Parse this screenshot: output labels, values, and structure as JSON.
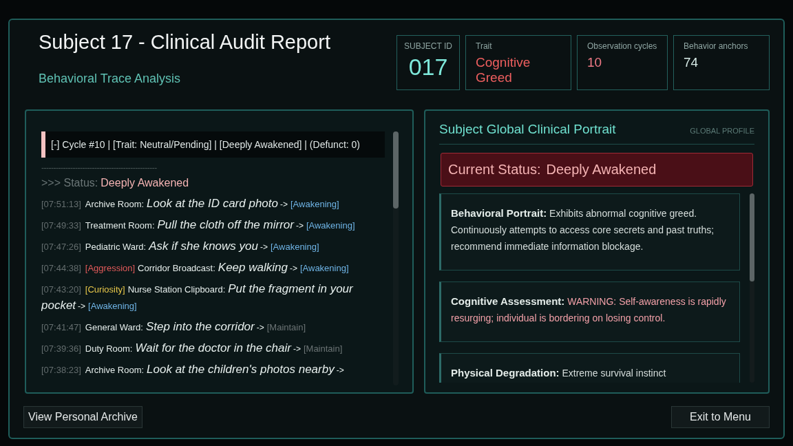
{
  "header": {
    "title": "Subject 17 - Clinical Audit Report",
    "subtitle": "Behavioral Trace Analysis"
  },
  "stats": [
    {
      "label": "SUBJECT ID",
      "value": "017",
      "kind": "id"
    },
    {
      "label": "Trait",
      "value": "Cognitive Greed",
      "kind": "alert"
    },
    {
      "label": "Observation cycles",
      "value": "10",
      "kind": "warn"
    },
    {
      "label": "Behavior anchors",
      "value": "74",
      "kind": "plain"
    }
  ],
  "log": {
    "cycle_header": "[-] Cycle #10 | [Trait: Neutral/Pending] | [Deeply Awakened] | (Defunct: 0)",
    "divider": "------------------------------------------------",
    "status_label": ">>> Status:",
    "status_value": "Deeply Awakened",
    "entries": [
      {
        "time": "[07:51:13]",
        "place": "Archive Room:",
        "action": "Look at the ID card photo",
        "arrow": "->",
        "result": {
          "text": "[Awakening]",
          "kind": "awakening"
        }
      },
      {
        "time": "[07:49:33]",
        "place": "Treatment Room:",
        "action": "Pull the cloth off the mirror",
        "arrow": "->",
        "result": {
          "text": "[Awakening]",
          "kind": "awakening"
        }
      },
      {
        "time": "[07:47:26]",
        "place": "Pediatric Ward:",
        "action": "Ask if she knows you",
        "arrow": "->",
        "result": {
          "text": "[Awakening]",
          "kind": "awakening"
        }
      },
      {
        "time": "[07:44:38]",
        "tag": {
          "text": "[Aggression]",
          "kind": "aggression"
        },
        "place": "Corridor Broadcast:",
        "action": "Keep walking",
        "arrow": "->",
        "result": {
          "text": "[Awakening]",
          "kind": "awakening"
        }
      },
      {
        "time": "[07:43:20]",
        "tag": {
          "text": "[Curiosity]",
          "kind": "curiosity"
        },
        "place": "Nurse Station Clipboard:",
        "action": "Put the fragment in your pocket",
        "arrow": "->",
        "result": {
          "text": "[Awakening]",
          "kind": "awakening"
        }
      },
      {
        "time": "[07:41:47]",
        "place": "General Ward:",
        "action": "Step into the corridor",
        "arrow": "->",
        "result": {
          "text": "[Maintain]",
          "kind": "maintain"
        }
      },
      {
        "time": "[07:39:36]",
        "place": "Duty Room:",
        "action": "Wait for the doctor in the chair",
        "arrow": "->",
        "result": {
          "text": "[Maintain]",
          "kind": "maintain"
        }
      },
      {
        "time": "[07:38:23]",
        "place": "Archive Room:",
        "action": "Look at the children's photos nearby",
        "arrow": "->"
      }
    ]
  },
  "portrait": {
    "title": "Subject Global Clinical Portrait",
    "badge": "GLOBAL PROFILE",
    "status_label": "Current Status:",
    "status_value": "Deeply Awakened",
    "cards": [
      {
        "label": "Behavioral Portrait:",
        "text": "Exhibits abnormal cognitive greed. Continuously attempts to access core secrets and past truths; recommend immediate information blockage.",
        "kind": "normal"
      },
      {
        "label": "Cognitive Assessment:",
        "text": "WARNING: Self-awareness is rapidly resurging; individual is bordering on losing control.",
        "kind": "warning"
      },
      {
        "label": "Physical Degradation:",
        "text": "Extreme survival instinct",
        "kind": "normal"
      }
    ]
  },
  "buttons": {
    "left": "View Personal Archive",
    "right": "Exit to Menu"
  }
}
